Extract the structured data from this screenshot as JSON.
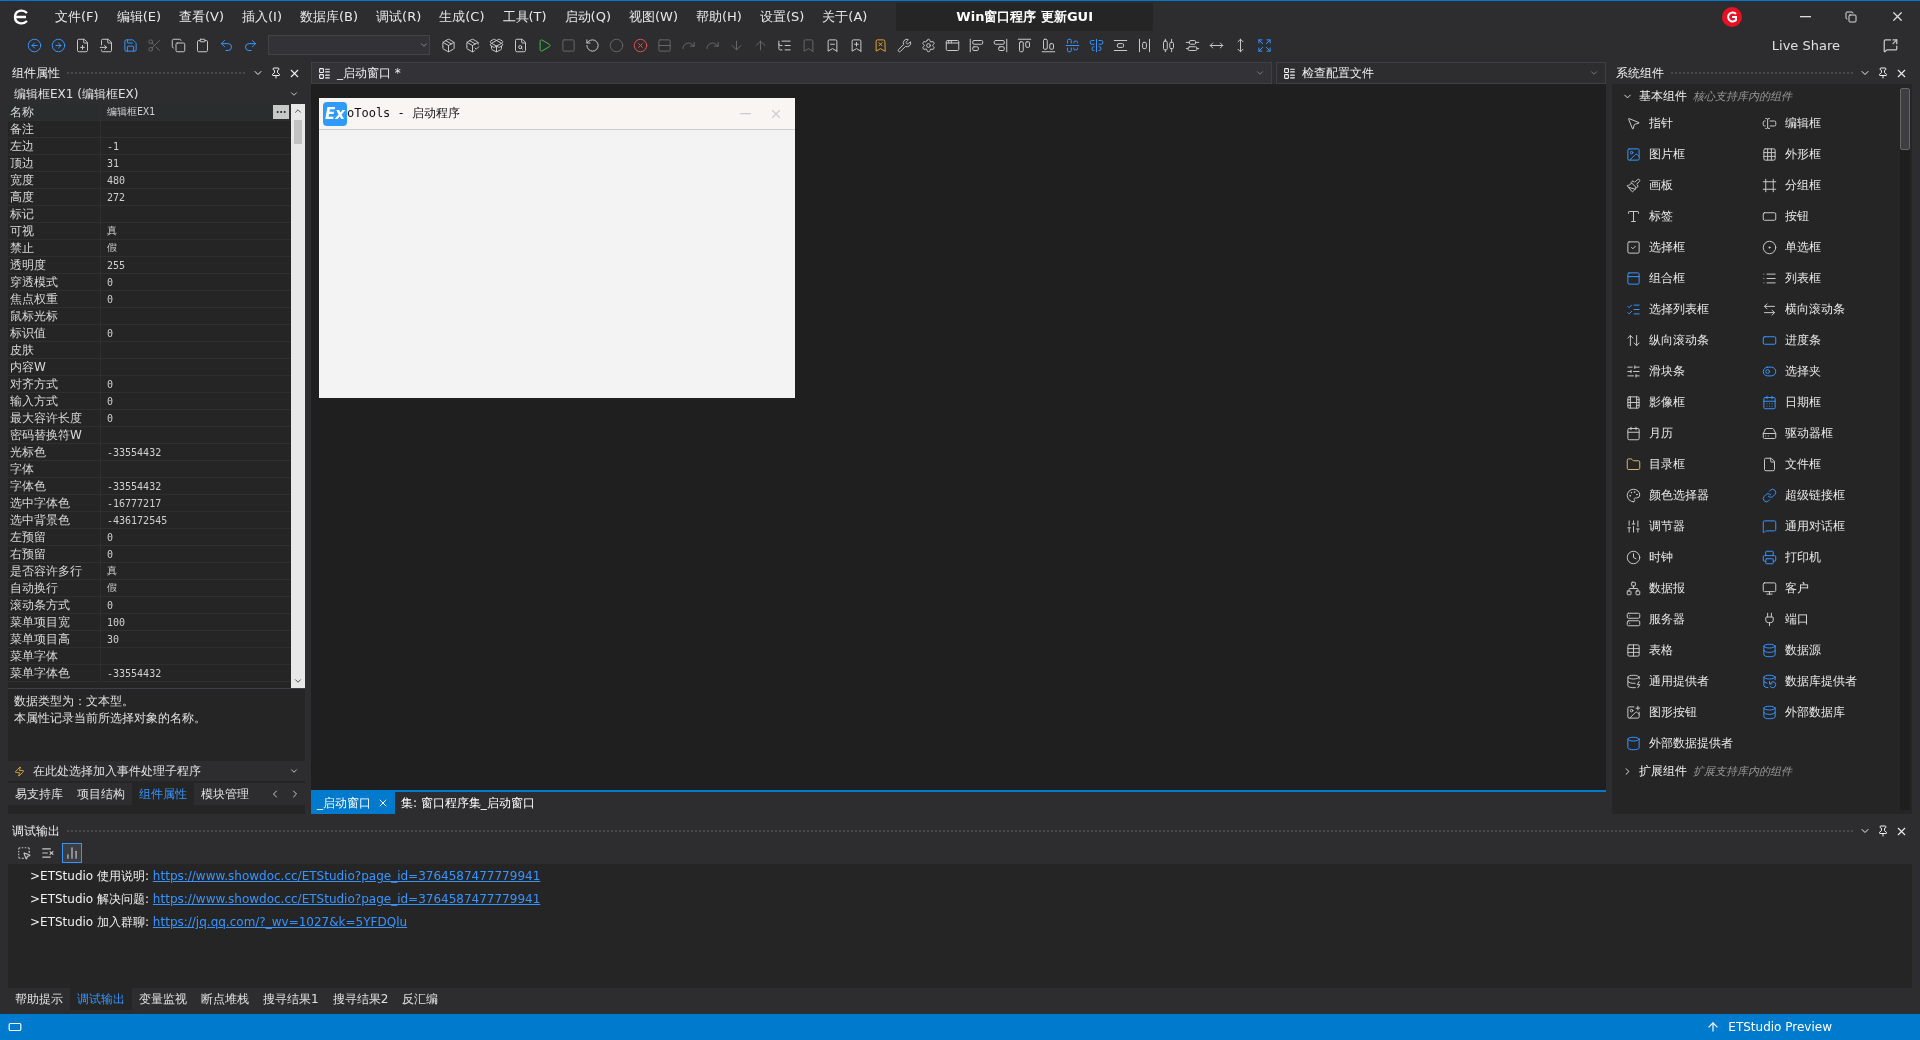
{
  "app": {
    "title": "Win窗口程序 更新GUI",
    "live_share": "Live Share"
  },
  "menu": [
    "文件(F)",
    "编辑(E)",
    "查看(V)",
    "插入(I)",
    "数据库(B)",
    "调试(R)",
    "生成(C)",
    "工具(T)",
    "启动(Q)",
    "视图(W)",
    "帮助(H)",
    "设置(S)",
    "关于(A)"
  ],
  "properties_panel": {
    "title": "组件属性",
    "object": "编辑框EX1 (编辑框EX)",
    "rows": [
      {
        "name": "名称",
        "value": "编辑框EX1",
        "selected": true
      },
      {
        "name": "备注",
        "value": "",
        "selected": false
      },
      {
        "name": "左边",
        "value": "-1",
        "selected": false
      },
      {
        "name": "顶边",
        "value": "31",
        "selected": false
      },
      {
        "name": "宽度",
        "value": "480",
        "selected": false
      },
      {
        "name": "高度",
        "value": "272",
        "selected": false
      },
      {
        "name": "标记",
        "value": "",
        "selected": false
      },
      {
        "name": "可视",
        "value": "真",
        "selected": false
      },
      {
        "name": "禁止",
        "value": "假",
        "selected": false
      },
      {
        "name": "透明度",
        "value": "255",
        "selected": false
      },
      {
        "name": "穿透模式",
        "value": "0",
        "selected": false
      },
      {
        "name": "焦点权重",
        "value": "0",
        "selected": false
      },
      {
        "name": "鼠标光标",
        "value": "",
        "selected": false
      },
      {
        "name": "标识值",
        "value": "0",
        "selected": false
      },
      {
        "name": "皮肤",
        "value": "",
        "selected": false
      },
      {
        "name": "内容W",
        "value": "",
        "selected": false
      },
      {
        "name": "对齐方式",
        "value": "0",
        "selected": false
      },
      {
        "name": "输入方式",
        "value": "0",
        "selected": false
      },
      {
        "name": "最大容许长度",
        "value": "0",
        "selected": false
      },
      {
        "name": "密码替换符W",
        "value": "",
        "selected": false
      },
      {
        "name": "光标色",
        "value": "-33554432",
        "selected": false
      },
      {
        "name": "字体",
        "value": "",
        "selected": false
      },
      {
        "name": "字体色",
        "value": "-33554432",
        "selected": false
      },
      {
        "name": "选中字体色",
        "value": "-16777217",
        "selected": false
      },
      {
        "name": "选中背景色",
        "value": "-436172545",
        "selected": false
      },
      {
        "name": "左预留",
        "value": "0",
        "selected": false
      },
      {
        "name": "右预留",
        "value": "0",
        "selected": false
      },
      {
        "name": "是否容许多行",
        "value": "真",
        "selected": false
      },
      {
        "name": "自动换行",
        "value": "假",
        "selected": false
      },
      {
        "name": "滚动条方式",
        "value": "0",
        "selected": false
      },
      {
        "name": "菜单项目宽",
        "value": "100",
        "selected": false
      },
      {
        "name": "菜单项目高",
        "value": "30",
        "selected": false
      },
      {
        "name": "菜单字体",
        "value": "",
        "selected": false
      },
      {
        "name": "菜单字体色",
        "value": "-33554432",
        "selected": false
      }
    ],
    "description": [
      "数据类型为：文本型。",
      "本属性记录当前所选择对象的名称。"
    ],
    "event_selector": "在此处选择加入事件处理子程序",
    "tabs": [
      {
        "label": "易支持库",
        "selected": false
      },
      {
        "label": "项目结构",
        "selected": false
      },
      {
        "label": "组件属性",
        "selected": true
      },
      {
        "label": "模块管理",
        "selected": false
      }
    ]
  },
  "documents": {
    "tabs": [
      {
        "label": "_启动窗口 *",
        "selected": true
      },
      {
        "label": "检查配置文件",
        "selected": false
      }
    ],
    "form": {
      "logo": "Ex",
      "title": "oTools - 启动程序"
    },
    "bottom_tabs": [
      {
        "label": "_启动窗口",
        "selected": true
      },
      {
        "label": "集: 窗口程序集_启动窗口",
        "selected": false
      }
    ]
  },
  "components_panel": {
    "title": "系统组件",
    "sections": [
      {
        "label": "基本组件",
        "hint": "核心支持库内的组件",
        "expanded": true,
        "items": [
          "指针",
          "编辑框",
          "图片框",
          "外形框",
          "画板",
          "分组框",
          "标签",
          "按钮",
          "选择框",
          "单选框",
          "组合框",
          "列表框",
          "选择列表框",
          "横向滚动条",
          "纵向滚动条",
          "进度条",
          "滑块条",
          "选择夹",
          "影像框",
          "日期框",
          "月历",
          "驱动器框",
          "目录框",
          "文件框",
          "颜色选择器",
          "超级链接框",
          "调节器",
          "通用对话框",
          "时钟",
          "打印机",
          "数据报",
          "客户",
          "服务器",
          "端口",
          "表格",
          "数据源",
          "通用提供者",
          "数据库提供者",
          "图形按钮",
          "外部数据库",
          "外部数据提供者"
        ]
      },
      {
        "label": "扩展组件",
        "hint": "扩展支持库内的组件",
        "expanded": false
      }
    ]
  },
  "output_panel": {
    "title": "调试输出",
    "lines": [
      {
        "text": ">ETStudio 使用说明: ",
        "link": "https://www.showdoc.cc/ETStudio?page_id=3764587477779941"
      },
      {
        "text": ">ETStudio 解决问题: ",
        "link": "https://www.showdoc.cc/ETStudio?page_id=3764587477779941"
      },
      {
        "text": ">ETStudio 加入群聊: ",
        "link": "https://jq.qq.com/?_wv=1027&k=5YFDQlu"
      }
    ],
    "tabs": [
      {
        "label": "帮助提示",
        "selected": false
      },
      {
        "label": "调试输出",
        "selected": true
      },
      {
        "label": "变量监视",
        "selected": false
      },
      {
        "label": "断点堆栈",
        "selected": false
      },
      {
        "label": "搜寻结果1",
        "selected": false
      },
      {
        "label": "搜寻结果2",
        "selected": false
      },
      {
        "label": "反汇编",
        "selected": false
      }
    ]
  },
  "status_bar": {
    "text": "ETStudio Preview"
  }
}
